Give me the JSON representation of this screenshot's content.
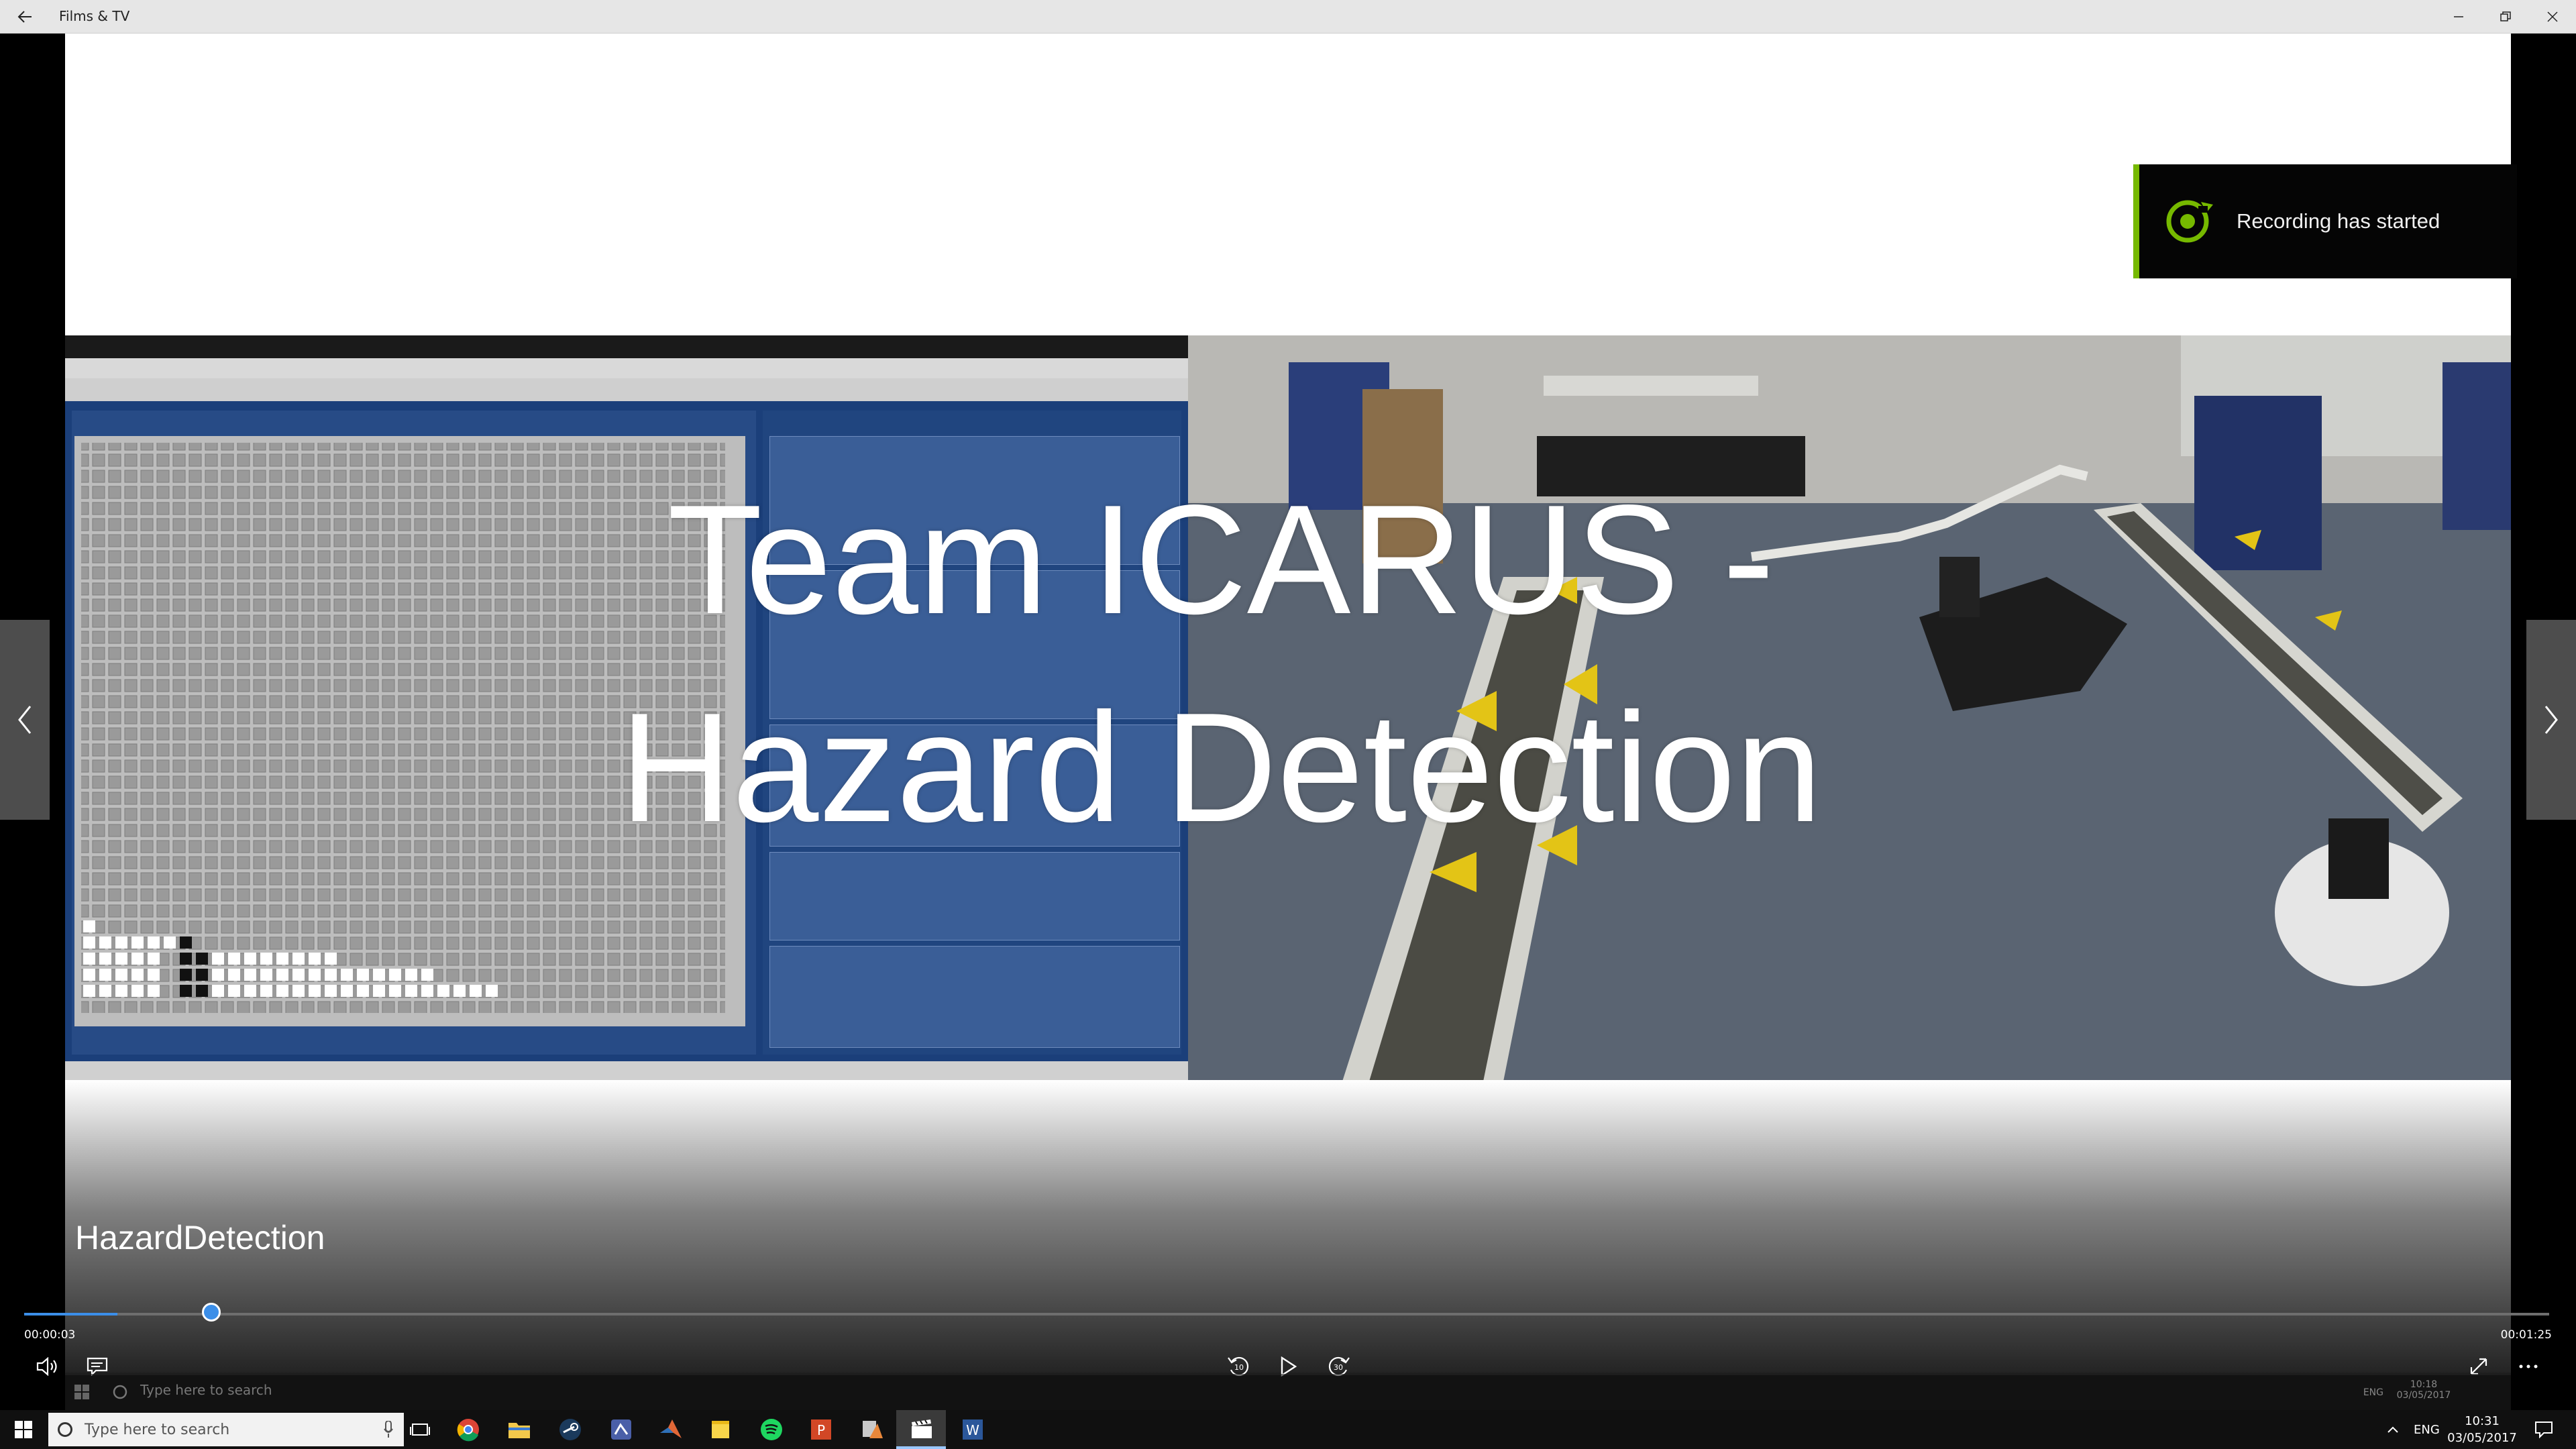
{
  "window": {
    "title": "Films & TV"
  },
  "video": {
    "overlay_title_line1": "Team ICARUS -",
    "overlay_title_line2": "Hazard Detection",
    "media_name": "HazardDetection",
    "time_current": "00:00:03",
    "time_total": "00:01:25",
    "progress": 0.037
  },
  "toast": {
    "text": "Recording has started",
    "accent": "#76b900"
  },
  "controls": {
    "volume_icon": "volume-icon",
    "captions_icon": "captions-icon",
    "skip_back_label": "10",
    "skip_forward_label": "30",
    "play_icon": "play-icon",
    "fullscreen_icon": "fullscreen-icon",
    "more_icon": "more-icon"
  },
  "inner_taskbar": {
    "search_placeholder": "Type here to search",
    "lang": "ENG",
    "time": "10:18",
    "date": "03/05/2017"
  },
  "taskbar": {
    "search_placeholder": "Type here to search",
    "apps": [
      "chrome",
      "file-explorer",
      "steam",
      "app-icon",
      "matlab",
      "sticky-notes",
      "spotify",
      "powerpoint",
      "app-icon-2",
      "films-tv",
      "word"
    ],
    "lang": "ENG",
    "time": "10:31",
    "date": "03/05/2017"
  },
  "colors": {
    "seek": "#3b8ee8",
    "taskbar": "#101010"
  }
}
